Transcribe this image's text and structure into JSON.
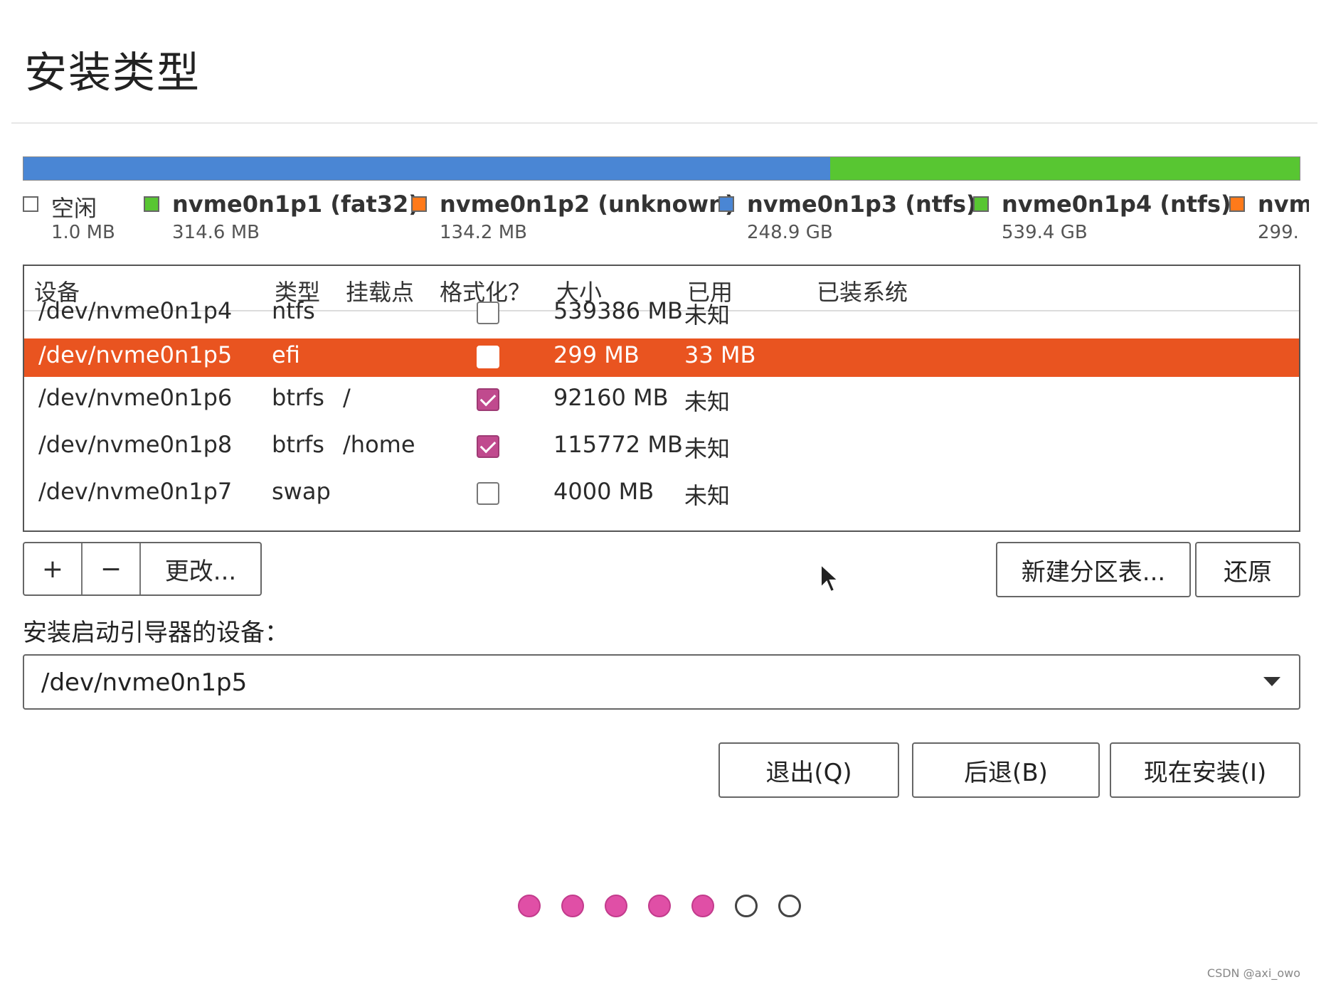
{
  "page": {
    "title": "安装类型"
  },
  "partition_bar": [
    {
      "fraction": 0.632,
      "color": "#4a86d4"
    },
    {
      "fraction": 0.368,
      "color": "#58c632"
    }
  ],
  "legend": [
    {
      "name": "空闲",
      "size": "1.0 MB",
      "color": "#ffffff"
    },
    {
      "name": "nvme0n1p1 (fat32)",
      "size": "314.6 MB",
      "color": "#58c632"
    },
    {
      "name": "nvme0n1p2 (unknown)",
      "size": "134.2 MB",
      "color": "#ff7a1a"
    },
    {
      "name": "nvme0n1p3 (ntfs)",
      "size": "248.9 GB",
      "color": "#4a86d4"
    },
    {
      "name": "nvme0n1p4 (ntfs)",
      "size": "539.4 GB",
      "color": "#58c632"
    },
    {
      "name": "nvm",
      "size": "299.",
      "color": "#ff7a1a"
    }
  ],
  "table": {
    "headers": [
      "设备",
      "类型",
      "挂载点",
      "格式化？",
      "大小",
      "已用",
      "已装系统"
    ],
    "rows": [
      {
        "device": "/dev/nvme0n1p4",
        "type": "ntfs",
        "mount": "",
        "format": false,
        "size": "539386 MB",
        "used": "未知",
        "os": "",
        "selected": false
      },
      {
        "device": "/dev/nvme0n1p5",
        "type": "efi",
        "mount": "",
        "format": false,
        "size": "299 MB",
        "used": "33 MB",
        "os": "",
        "selected": true
      },
      {
        "device": "/dev/nvme0n1p6",
        "type": "btrfs",
        "mount": "/",
        "format": true,
        "size": "92160 MB",
        "used": "未知",
        "os": "",
        "selected": false
      },
      {
        "device": "/dev/nvme0n1p8",
        "type": "btrfs",
        "mount": "/home",
        "format": true,
        "size": "115772 MB",
        "used": "未知",
        "os": "",
        "selected": false
      },
      {
        "device": "/dev/nvme0n1p7",
        "type": "swap",
        "mount": "",
        "format": false,
        "size": "4000 MB",
        "used": "未知",
        "os": "",
        "selected": false
      }
    ]
  },
  "toolbar": {
    "add_label": "+",
    "remove_label": "−",
    "change_label": "更改...",
    "new_table_label": "新建分区表...",
    "revert_label": "还原"
  },
  "bootloader": {
    "label": "安装启动引导器的设备：",
    "value": "/dev/nvme0n1p5"
  },
  "actions": {
    "quit_label": "退出(Q)",
    "back_label": "后退(B)",
    "install_label": "现在安装(I)"
  },
  "progress": {
    "total_steps": 7,
    "completed_steps": 5
  },
  "watermark": "CSDN @axi_owo",
  "colors": {
    "selected_row": "#e95420",
    "checkbox": "#c04a8e",
    "dot_filled": "#e04fa6"
  }
}
